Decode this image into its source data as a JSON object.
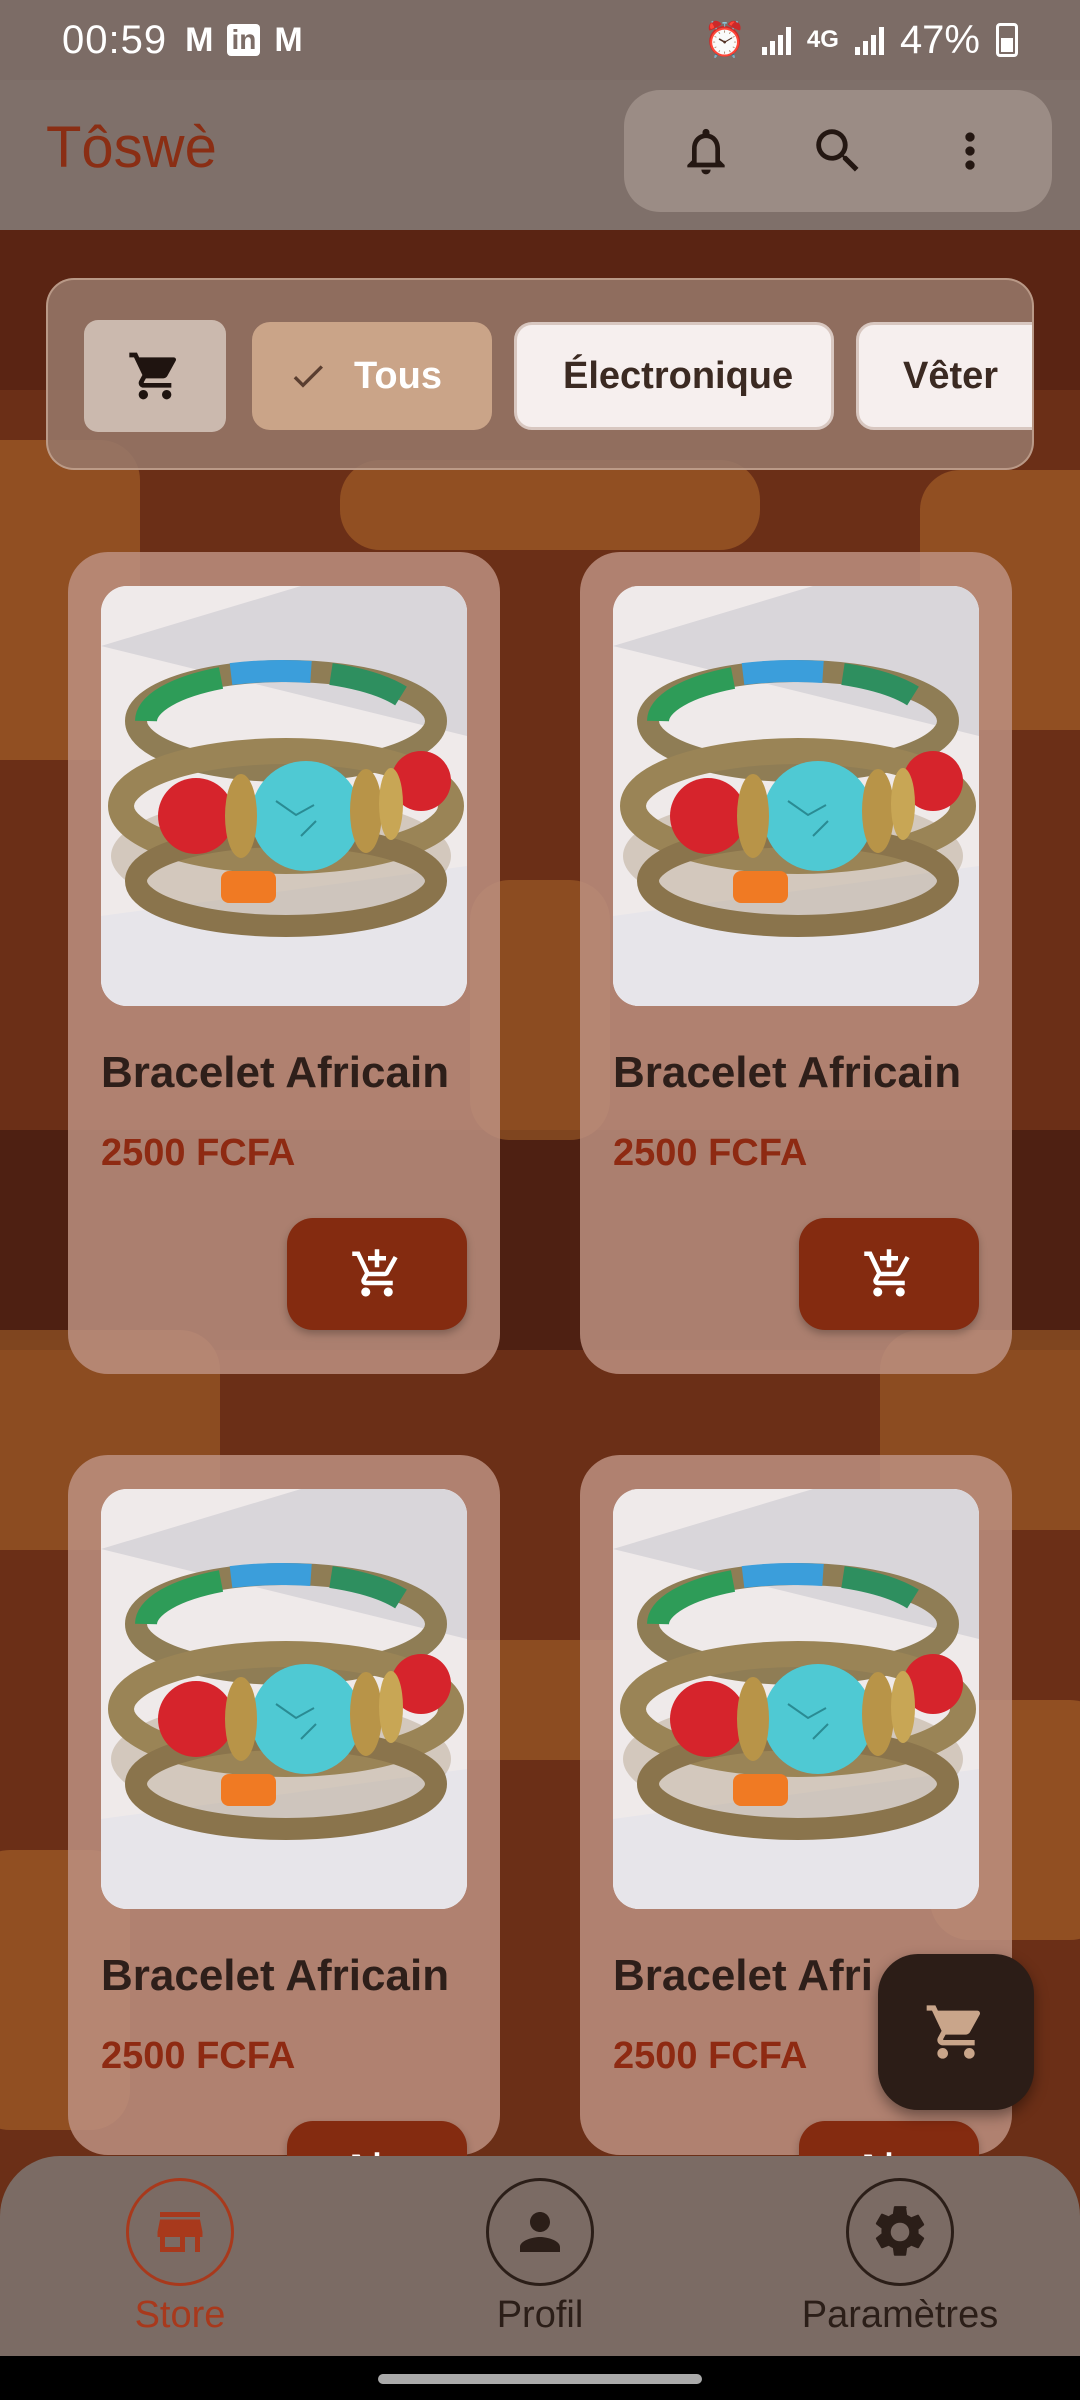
{
  "status_bar": {
    "time": "00:59",
    "notification_icons": [
      "gmail-icon",
      "linkedin-icon",
      "gmail-icon"
    ],
    "network": "4G",
    "battery": "47%"
  },
  "app_bar": {
    "title": "Tôswè",
    "actions": [
      "bell-icon",
      "search-icon",
      "more-vert-icon"
    ]
  },
  "filters": {
    "cart_icon": "cart-icon",
    "chips": [
      {
        "label": "Tous",
        "selected": true
      },
      {
        "label": "Électronique",
        "selected": false
      },
      {
        "label": "Vêter",
        "selected": false
      }
    ]
  },
  "products": [
    {
      "name": "Bracelet Africain",
      "price": "2500 FCFA",
      "action_icon": "add-shopping-cart-icon"
    },
    {
      "name": "Bracelet Africain",
      "price": "2500 FCFA",
      "action_icon": "add-shopping-cart-icon"
    },
    {
      "name": "Bracelet Africain",
      "price": "2500 FCFA",
      "action_icon": "add-shopping-cart-icon"
    },
    {
      "name": "Bracelet Afri",
      "price": "2500 FCFA",
      "action_icon": "add-shopping-cart-icon"
    }
  ],
  "fab": {
    "icon": "cart-icon"
  },
  "bottom_nav": {
    "items": [
      {
        "label": "Store",
        "icon": "store-icon",
        "active": true
      },
      {
        "label": "Profil",
        "icon": "person-icon",
        "active": false
      },
      {
        "label": "Paramètres",
        "icon": "settings-icon",
        "active": false
      }
    ]
  },
  "colors": {
    "brand": "#8a2e14",
    "accent_button": "#842b10",
    "price": "#8e2a12",
    "selected_chip": "#caa488",
    "nav_active": "#a8391c"
  }
}
